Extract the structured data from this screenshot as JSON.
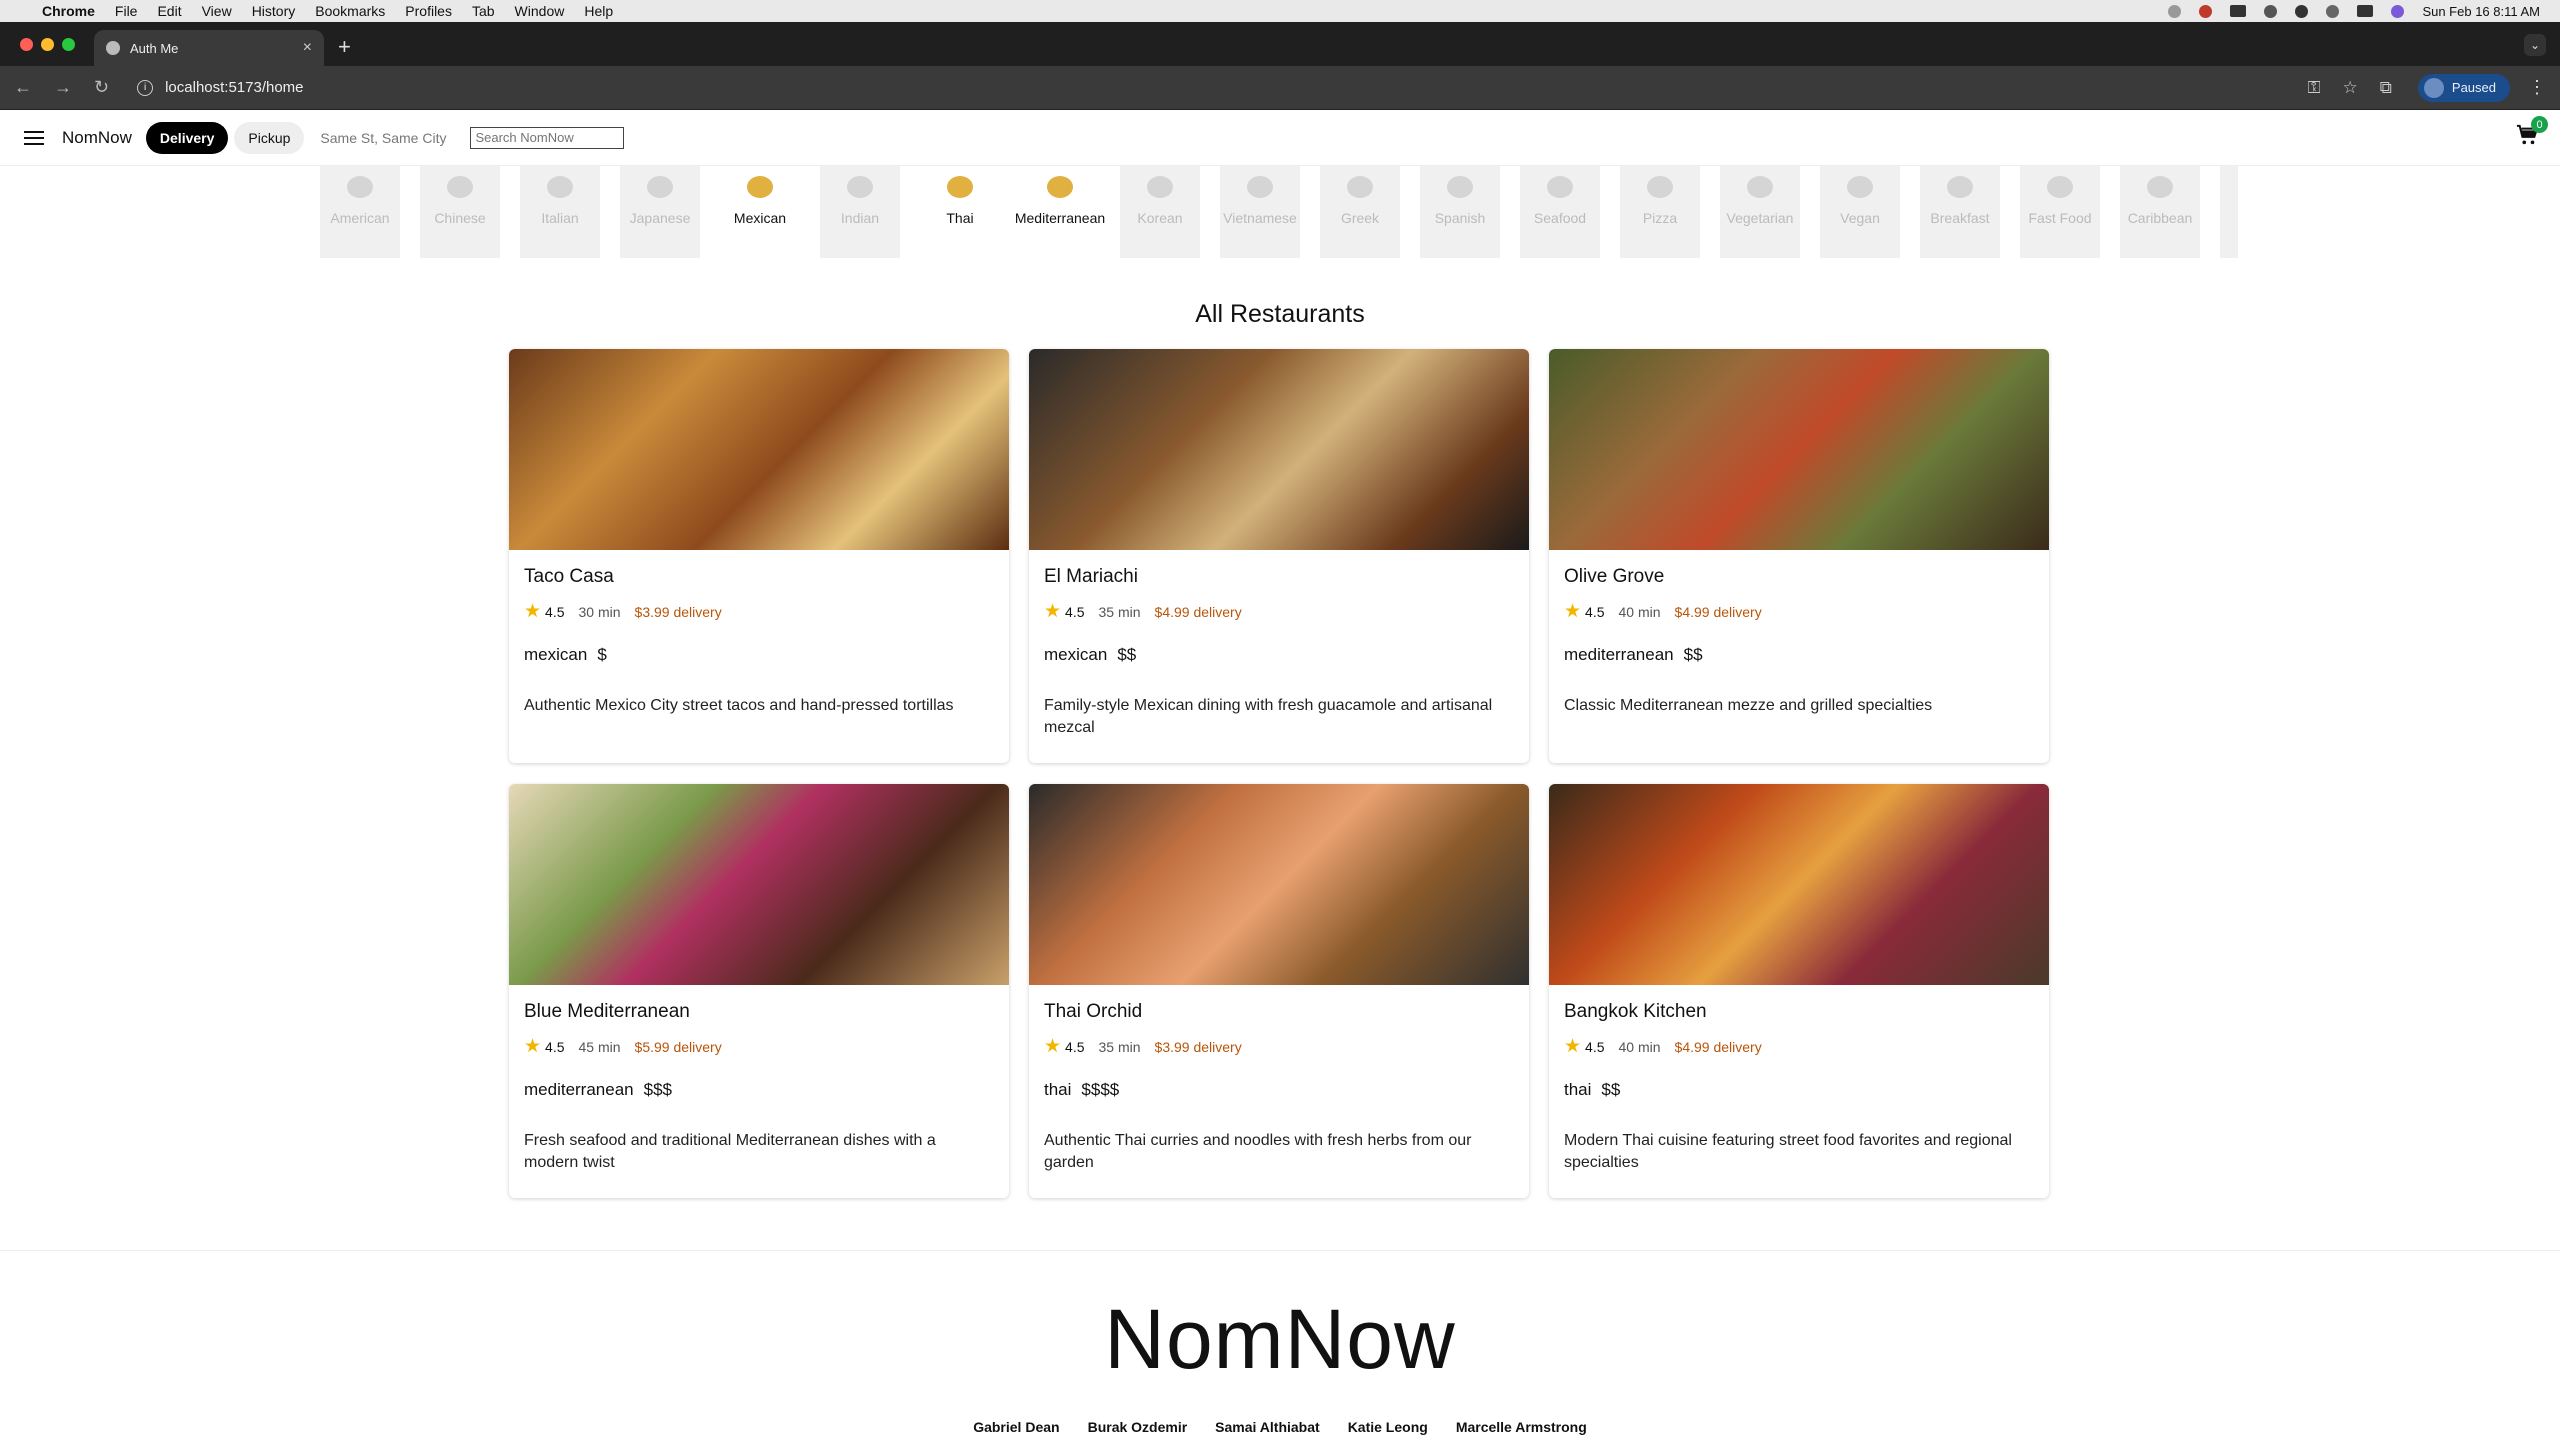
{
  "menubar": {
    "app": "Chrome",
    "items": [
      "File",
      "Edit",
      "View",
      "History",
      "Bookmarks",
      "Profiles",
      "Tab",
      "Window",
      "Help"
    ],
    "clock": "Sun Feb 16  8:11 AM"
  },
  "browser": {
    "tab_title": "Auth Me",
    "url": "localhost:5173/home",
    "profile_status": "Paused"
  },
  "header": {
    "brand": "NomNow",
    "delivery_label": "Delivery",
    "pickup_label": "Pickup",
    "address": "Same St, Same City",
    "search_placeholder": "Search NomNow",
    "cart_count": "0"
  },
  "cuisines": [
    {
      "label": "American",
      "active": false
    },
    {
      "label": "Chinese",
      "active": false
    },
    {
      "label": "Italian",
      "active": false
    },
    {
      "label": "Japanese",
      "active": false
    },
    {
      "label": "Mexican",
      "active": true
    },
    {
      "label": "Indian",
      "active": false
    },
    {
      "label": "Thai",
      "active": true
    },
    {
      "label": "Mediterranean",
      "active": true
    },
    {
      "label": "Korean",
      "active": false
    },
    {
      "label": "Vietnamese",
      "active": false
    },
    {
      "label": "Greek",
      "active": false
    },
    {
      "label": "Spanish",
      "active": false
    },
    {
      "label": "Seafood",
      "active": false
    },
    {
      "label": "Pizza",
      "active": false
    },
    {
      "label": "Vegetarian",
      "active": false
    },
    {
      "label": "Vegan",
      "active": false
    },
    {
      "label": "Breakfast",
      "active": false
    },
    {
      "label": "Fast Food",
      "active": false
    },
    {
      "label": "Caribbean",
      "active": false
    }
  ],
  "main": {
    "heading": "All Restaurants",
    "restaurants": [
      {
        "name": "Taco Casa",
        "rating": "4.5",
        "time": "30 min",
        "fee": "$3.99 delivery",
        "cuisine": "mexican",
        "price": "$",
        "description": "Authentic Mexico City street tacos and hand-pressed tortillas",
        "image": "img-taco"
      },
      {
        "name": "El Mariachi",
        "rating": "4.5",
        "time": "35 min",
        "fee": "$4.99 delivery",
        "cuisine": "mexican",
        "price": "$$",
        "description": "Family-style Mexican dining with fresh guacamole and artisanal mezcal",
        "image": "img-mariachi"
      },
      {
        "name": "Olive Grove",
        "rating": "4.5",
        "time": "40 min",
        "fee": "$4.99 delivery",
        "cuisine": "mediterranean",
        "price": "$$",
        "description": "Classic Mediterranean mezze and grilled specialties",
        "image": "img-olive"
      },
      {
        "name": "Blue Mediterranean",
        "rating": "4.5",
        "time": "45 min",
        "fee": "$5.99 delivery",
        "cuisine": "mediterranean",
        "price": "$$$",
        "description": "Fresh seafood and traditional Mediterranean dishes with a modern twist",
        "image": "img-bluemed"
      },
      {
        "name": "Thai Orchid",
        "rating": "4.5",
        "time": "35 min",
        "fee": "$3.99 delivery",
        "cuisine": "thai",
        "price": "$$$$",
        "description": "Authentic Thai curries and noodles with fresh herbs from our garden",
        "image": "img-thaiorchid"
      },
      {
        "name": "Bangkok Kitchen",
        "rating": "4.5",
        "time": "40 min",
        "fee": "$4.99 delivery",
        "cuisine": "thai",
        "price": "$$",
        "description": "Modern Thai cuisine featuring street food favorites and regional specialties",
        "image": "img-bangkok"
      }
    ]
  },
  "footer": {
    "logo": "NomNow",
    "team": [
      "Gabriel Dean",
      "Burak Ozdemir",
      "Samai Althiabat",
      "Katie Leong",
      "Marcelle Armstrong"
    ]
  },
  "colors": {
    "accent": "#000000",
    "fee": "#b8550a",
    "star": "#f2b600",
    "cart_badge": "#18a34a"
  }
}
